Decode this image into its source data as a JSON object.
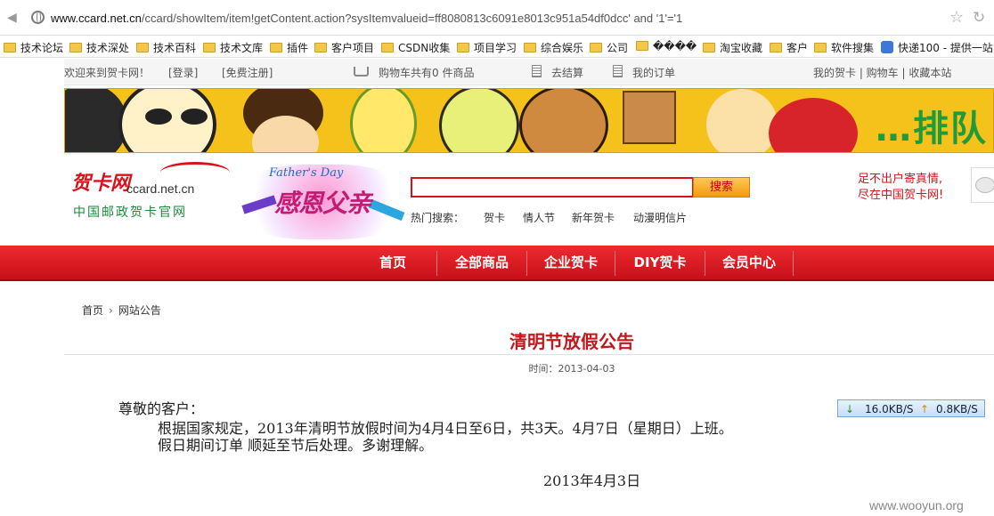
{
  "browser": {
    "url_domain": "www.ccard.net.cn",
    "url_path": "/ccard/showItem/item!getContent.action?sysItemvalueid=ff8080813c6091e8013c951a54df0dcc' and '1'='1"
  },
  "bookmarks": [
    {
      "label": "技术论坛"
    },
    {
      "label": "技术深处"
    },
    {
      "label": "技术百科"
    },
    {
      "label": "技术文库"
    },
    {
      "label": "插件"
    },
    {
      "label": "客户项目"
    },
    {
      "label": "CSDN收集"
    },
    {
      "label": "项目学习"
    },
    {
      "label": "综合娱乐"
    },
    {
      "label": "公司"
    },
    {
      "label": "����"
    },
    {
      "label": "淘宝收藏"
    },
    {
      "label": "客户"
    },
    {
      "label": "软件搜集"
    },
    {
      "label": "快递100 - 提供一站"
    }
  ],
  "topbar": {
    "welcome": "欢迎来到贺卡网！",
    "login": "[登录]",
    "register": "[免费注册]",
    "cart_status": "购物车共有0  件商品",
    "checkout": "去结算",
    "my_orders": "我的订单",
    "right_links": "我的贺卡  |  购物车  |    收藏本站"
  },
  "banner": {
    "text": "…排队"
  },
  "logo": {
    "cn": "贺卡网",
    "en": "ccard.net.cn",
    "subtitle": "中国邮政贺卡官网"
  },
  "promo": {
    "en": "Father's Day",
    "cn": "感恩父亲"
  },
  "search": {
    "value": "",
    "button": "搜索"
  },
  "hot_search": {
    "label": "热门搜索：",
    "items": [
      "贺卡",
      "情人节",
      "新年贺卡",
      "动漫明信片"
    ]
  },
  "slogan": {
    "line1": "足不出户寄真情,",
    "line2": "尽在中国贺卡网!"
  },
  "nav": [
    "首页",
    "全部商品",
    "企业贺卡",
    "DIY贺卡",
    "会员中心"
  ],
  "breadcrumb": {
    "home": "首页",
    "current": "网站公告"
  },
  "article": {
    "title": "清明节放假公告",
    "date": "时间：2013-04-03",
    "greeting": "尊敬的客户：",
    "line1": "根据国家规定，2013年清明节放假时间为4月4日至6日，共3天。4月7日（星期日）上班。",
    "line2": "假日期间订单 顺延至节后处理。多谢理解。",
    "sign_date": "2013年4月3日"
  },
  "speed_meter": {
    "down": "16.0KB/S",
    "up": "0.8KB/S"
  },
  "watermark": "www.wooyun.org",
  "colors": {
    "brand_red": "#d7121b",
    "nav_red": "#e01f26",
    "green": "#1b8a3a"
  }
}
